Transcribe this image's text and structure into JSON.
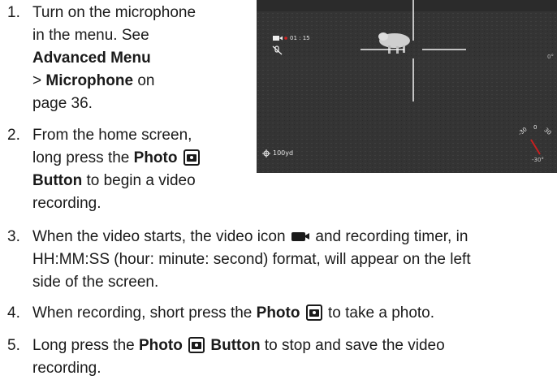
{
  "steps": [
    {
      "n": "1.",
      "lines": [
        "Turn on the microphone",
        "in the menu. See"
      ],
      "bold1": "Advanced Menu",
      "pre2": "> ",
      "bold2": "Microphone",
      "post2": " on",
      "last": "page 36."
    },
    {
      "n": "2.",
      "l1": "From the home screen,",
      "l2": "long press the ",
      "b1": "Photo",
      "b2": "Button",
      "l3rest": " to begin a video",
      "l4": "recording."
    },
    {
      "n": "3.",
      "a": "When the video starts, the video icon",
      "b": "and recording timer, in",
      "c": "HH:MM:SS (hour: minute: second) format, will appear on the left",
      "d": "side of the screen."
    },
    {
      "n": "4.",
      "a": "When recording, short press the ",
      "b": "Photo",
      "c": " to take a photo."
    },
    {
      "n": "5.",
      "a": "Long press the ",
      "b": "Photo",
      "c": "Button",
      "d": " to stop and save the video",
      "e": "recording."
    }
  ],
  "scope": {
    "timer": "01 : 15",
    "range": "100yd",
    "angle_right": "0°",
    "angle_bottom": "-30°",
    "dial": [
      "-30",
      "0",
      "30"
    ]
  },
  "icons": {
    "photo": "camera-icon",
    "video": "video-camera-icon",
    "mic_off": "mic-off-icon",
    "reticle": "reticle-icon"
  }
}
